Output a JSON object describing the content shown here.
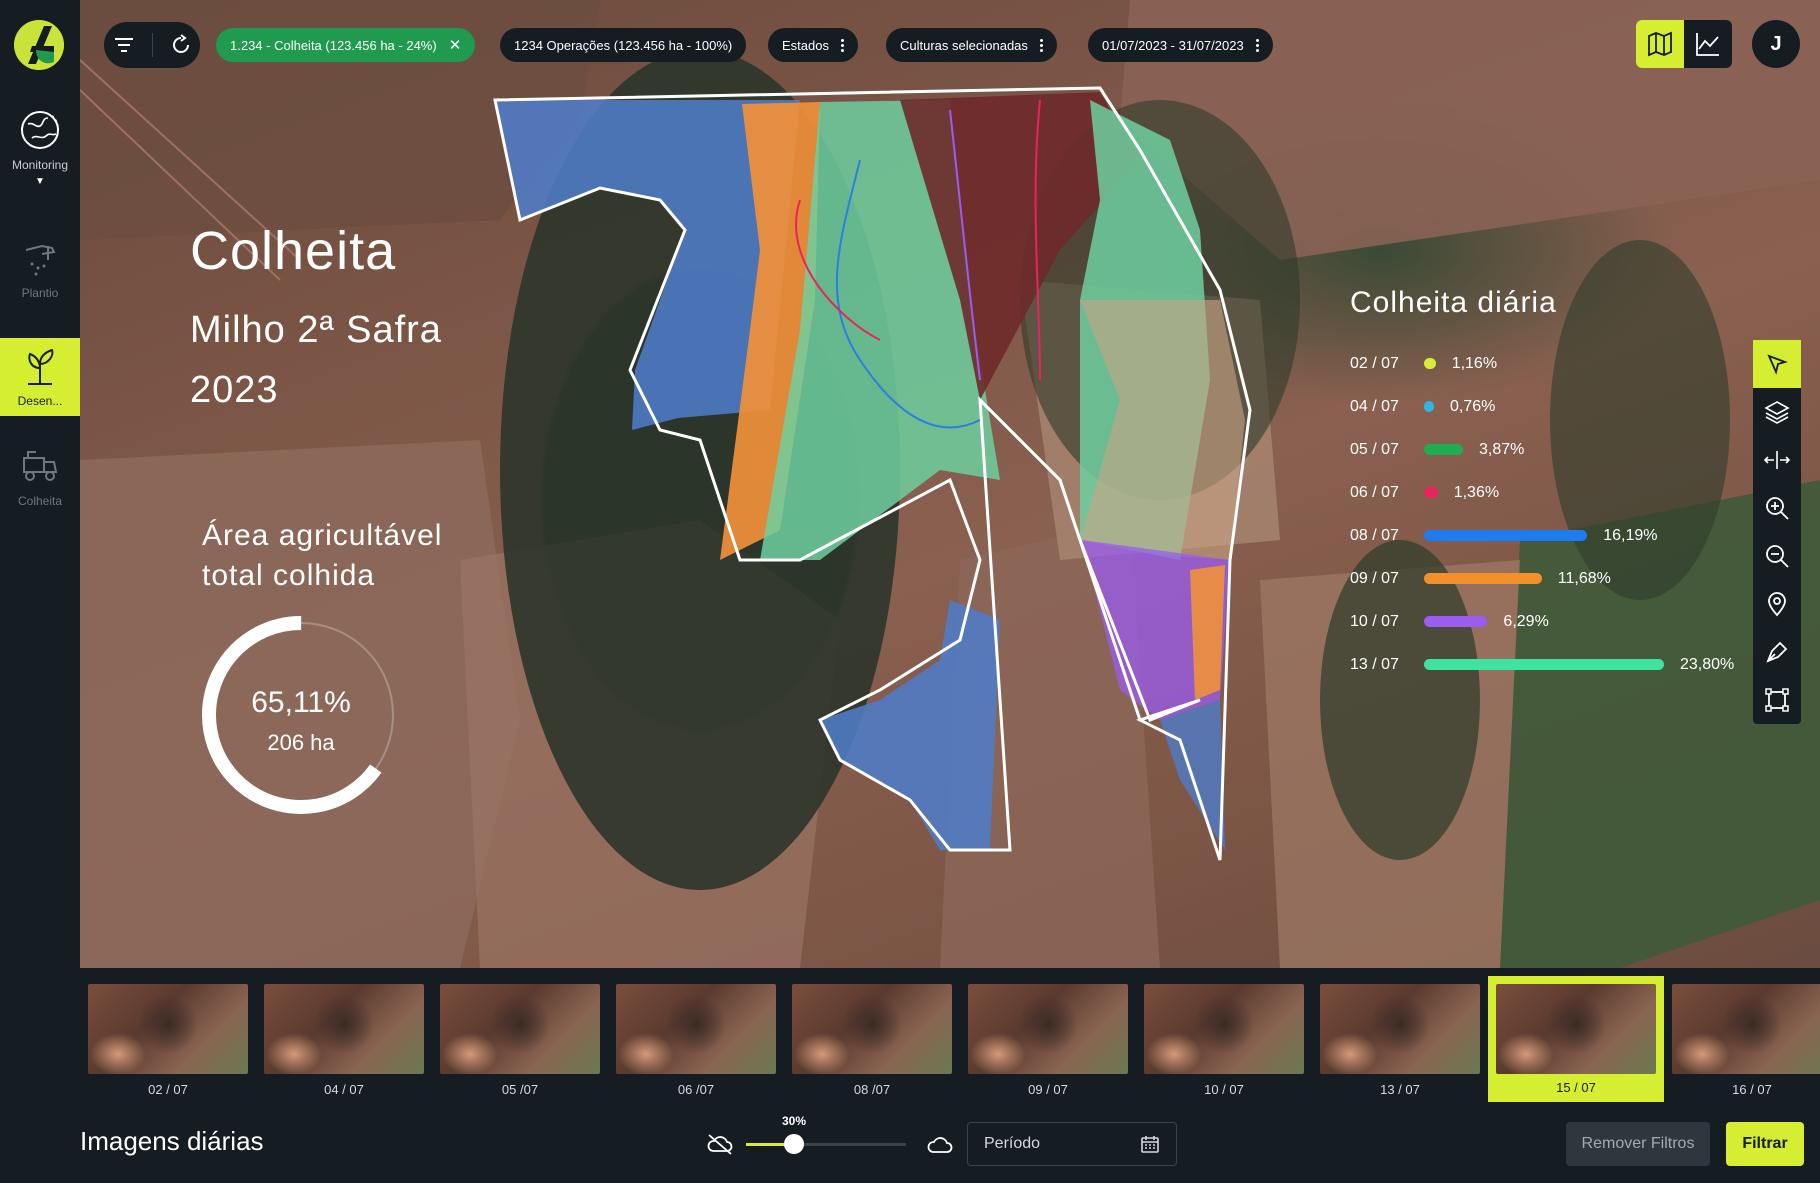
{
  "sidebar": {
    "items": [
      {
        "label": "Monitoring",
        "icon": "globe-icon"
      },
      {
        "label": "Plantio",
        "icon": "planting-icon"
      },
      {
        "label": "Desen...",
        "icon": "sprout-icon"
      },
      {
        "label": "Colheita",
        "icon": "harvester-icon"
      }
    ]
  },
  "topbar": {
    "chips": [
      {
        "label": "1.234 - Colheita (123.456 ha - 24%)"
      },
      {
        "label": "1234 Operações (123.456 ha - 100%)"
      },
      {
        "label": "Estados"
      },
      {
        "label": "Culturas selecionadas"
      },
      {
        "label": "01/07/2023 - 31/07/2023"
      }
    ],
    "user_initial": "J"
  },
  "overlay": {
    "title": "Colheita",
    "crop": "Milho 2ª Safra",
    "year": "2023",
    "area_label_1": "Área agricultável",
    "area_label_2": "total colhida",
    "percent_text": "65,11%",
    "percent": 65.11,
    "hectares": "206 ha"
  },
  "legend": {
    "title": "Colheita diária",
    "items": [
      {
        "date": "02 / 07",
        "pct": "1,16%",
        "value": 1.16,
        "color": "#d6ee32"
      },
      {
        "date": "04 / 07",
        "pct": "0,76%",
        "value": 0.76,
        "color": "#2ab8e6"
      },
      {
        "date": "05 / 07",
        "pct": "3,87%",
        "value": 3.87,
        "color": "#1fae4f"
      },
      {
        "date": "06 / 07",
        "pct": "1,36%",
        "value": 1.36,
        "color": "#e8245e"
      },
      {
        "date": "08 / 07",
        "pct": "16,19%",
        "value": 16.19,
        "color": "#1e7cf0"
      },
      {
        "date": "09 / 07",
        "pct": "11,68%",
        "value": 11.68,
        "color": "#f4902a"
      },
      {
        "date": "10 / 07",
        "pct": "6,29%",
        "value": 6.29,
        "color": "#9b5cf0"
      },
      {
        "date": "13 / 07",
        "pct": "23,80%",
        "value": 23.8,
        "color": "#3ee3a0"
      }
    ]
  },
  "tools": [
    "cursor-icon",
    "layers-icon",
    "split-icon",
    "zoom-in-icon",
    "zoom-out-icon",
    "pin-icon",
    "pen-icon",
    "crop-icon"
  ],
  "timeline": {
    "thumbs": [
      {
        "label": "02 / 07"
      },
      {
        "label": "04 / 07"
      },
      {
        "label": "05 /07"
      },
      {
        "label": "06 /07"
      },
      {
        "label": "08 /07"
      },
      {
        "label": "09 / 07"
      },
      {
        "label": "10 / 07"
      },
      {
        "label": "13 / 07"
      },
      {
        "label": "15 / 07"
      },
      {
        "label": "16 / 07"
      }
    ],
    "selected_index": 8
  },
  "bottom": {
    "title": "Imagens diárias",
    "cloud_pct_text": "30%",
    "cloud_pct": 30,
    "period_placeholder": "Período",
    "remove_label": "Remover Filtros",
    "filter_label": "Filtrar"
  }
}
